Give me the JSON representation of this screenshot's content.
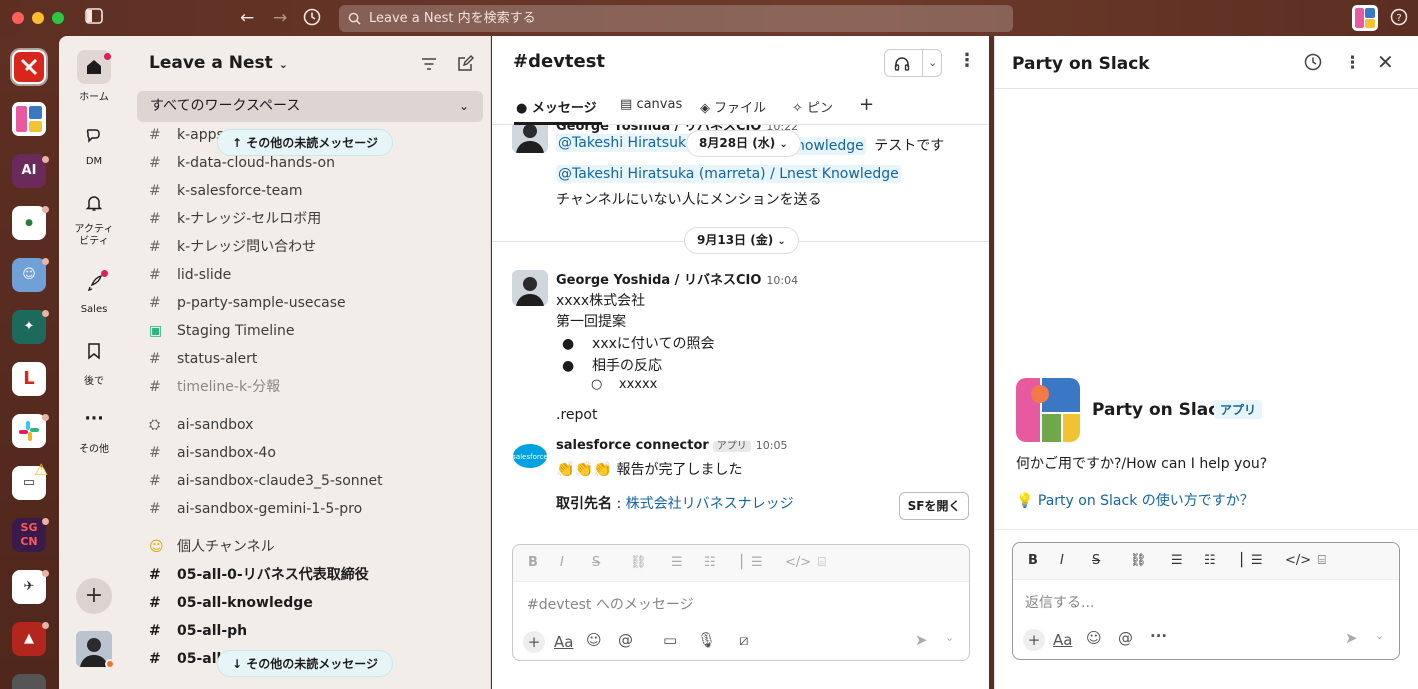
{
  "search": {
    "placeholder": "Leave a Nest 内を検索する"
  },
  "nav": {
    "home": "ホーム",
    "dm": "DM",
    "activity": "アクティ\nビティ",
    "sales": "Sales",
    "later": "後で",
    "more": "その他"
  },
  "sidebar": {
    "workspace_name": "Leave a Nest",
    "filter_label": "すべてのワークスペース",
    "channels": [
      {
        "name": "k-apps",
        "type": "channel",
        "style": "normal"
      },
      {
        "name": "k-data-cloud-hands-on",
        "type": "channel",
        "style": "normal"
      },
      {
        "name": "k-salesforce-team",
        "type": "channel",
        "style": "normal"
      },
      {
        "name": "k-ナレッジ-セルロボ用",
        "type": "channel",
        "style": "normal"
      },
      {
        "name": "k-ナレッジ問い合わせ",
        "type": "channel",
        "style": "normal"
      },
      {
        "name": "lid-slide",
        "type": "channel",
        "style": "normal"
      },
      {
        "name": "p-party-sample-usecase",
        "type": "channel",
        "style": "normal"
      },
      {
        "name": "Staging Timeline",
        "type": "app",
        "style": "normal"
      },
      {
        "name": "status-alert",
        "type": "channel",
        "style": "normal"
      },
      {
        "name": "timeline-k-分報",
        "type": "channel",
        "style": "muted"
      },
      {
        "name": "ai-sandbox",
        "type": "robot",
        "style": "normal"
      },
      {
        "name": "ai-sandbox-4o",
        "type": "channel",
        "style": "normal"
      },
      {
        "name": "ai-sandbox-claude3_5-sonnet",
        "type": "channel",
        "style": "normal"
      },
      {
        "name": "ai-sandbox-gemini-1-5-pro",
        "type": "channel",
        "style": "normal"
      },
      {
        "name": "個人チャンネル",
        "type": "emoji",
        "style": "normal"
      },
      {
        "name": "05-all-0-リバネス代表取締役",
        "type": "channel",
        "style": "bold"
      },
      {
        "name": "05-all-knowledge",
        "type": "channel",
        "style": "bold"
      },
      {
        "name": "05-all-ph",
        "type": "channel",
        "style": "bold"
      },
      {
        "name": "05-all-",
        "type": "channel",
        "style": "bold"
      }
    ],
    "unread_top": "その他の未読メッセージ",
    "unread_bottom": "その他の未読メッセージ"
  },
  "channel": {
    "title": "#devtest",
    "tabs": [
      "メッセージ",
      "canvas",
      "ファイル",
      "ピン"
    ],
    "date_pill_1": "8月28日 (水)",
    "date_pill_2": "9月13日 (金)",
    "partial_author": "George Yoshida / リバネスCIO",
    "partial_time": "10:22",
    "msg1_mention_a": "@Takeshi Hiratsuka (",
    "msg1_mention_a_end": "nowledge",
    "msg1_suffix": "テストです",
    "msg1_mention_b": "@Takeshi Hiratsuka (marreta) / Lnest Knowledge",
    "msg1_line3": "チャンネルにいない人にメンションを送る",
    "msg2": {
      "author": "George Yoshida / リバネスCIO",
      "time": "10:04",
      "lines": [
        "xxxx株式会社",
        "第一回提案"
      ],
      "bullets": [
        "xxxに付いての照会",
        "相手の反応"
      ],
      "sub_bullet": "xxxxx",
      "footer": ".repot"
    },
    "msg3": {
      "author": "salesforce connector",
      "tag": "アプリ",
      "time": "10:05",
      "emoji": "👏👏👏",
      "text": "報告が完了しました",
      "field_label": "取引先名",
      "field_sep": " : ",
      "field_value": "株式会社リバネスナレッジ",
      "button": "SFを開く",
      "avatar_text": "salesforce"
    },
    "composer_placeholder": "#devtest へのメッセージ"
  },
  "panel": {
    "title": "Party on Slack",
    "bot_name": "Party on Slack",
    "bot_tag": "アプリ",
    "bot_message": "何かご用ですか?/How can I help you?",
    "bot_link": "Party on Slack の使い方ですか？",
    "reply_placeholder": "返信する..."
  },
  "colors": {
    "titlebar": "#5d2f23",
    "sidebar_bg": "#f3ede9",
    "link": "#1264a3",
    "mention_bg": "#e8f5fa",
    "unread_pill": "#e6f6f8"
  }
}
